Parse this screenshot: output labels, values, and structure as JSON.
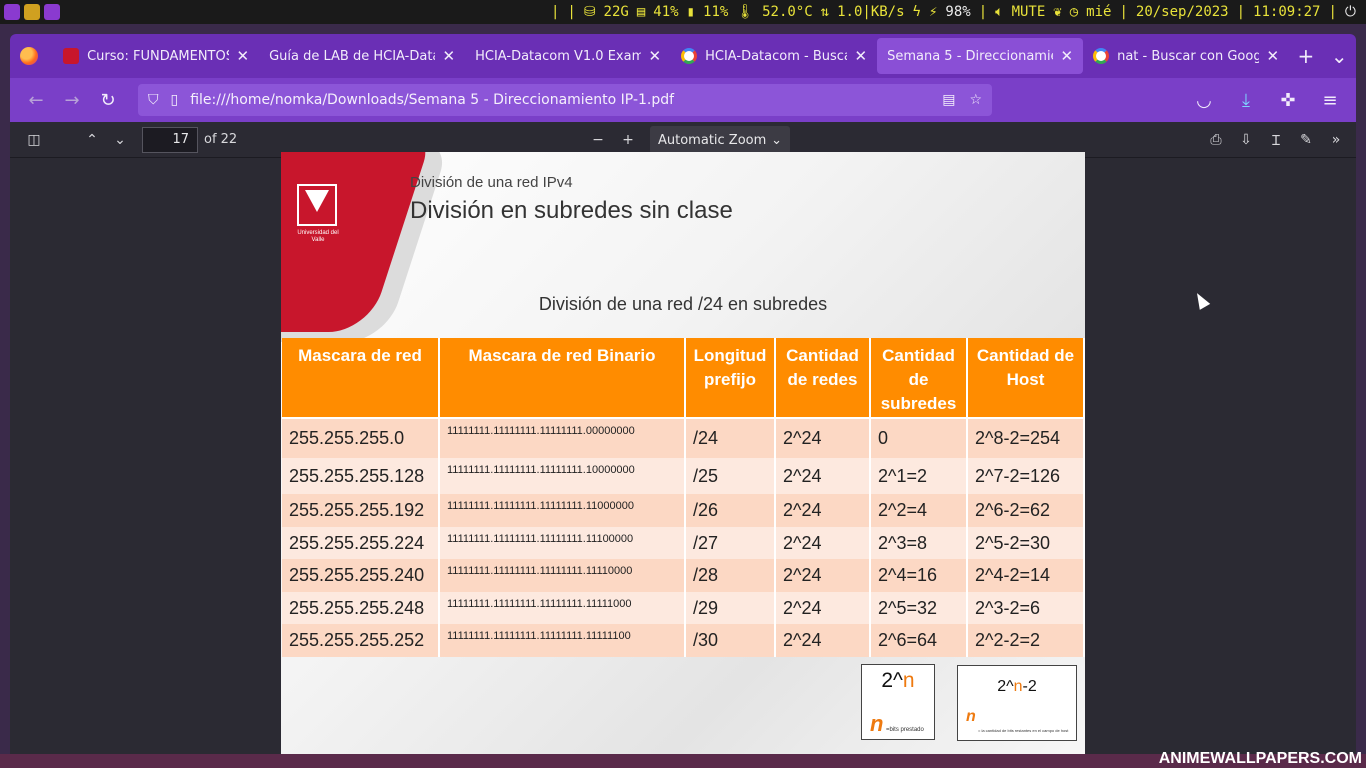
{
  "system_bar": {
    "disk": "22G",
    "memory": "41%",
    "swap": "11%",
    "temperature": "52.0°C",
    "network": "1.0|KB/s",
    "battery": "98%",
    "volume": "MUTE",
    "day": "mié",
    "date": "20/sep/2023",
    "time": "11:09:27",
    "icons": [
      "terminal-icon",
      "firefox-icon",
      "music-icon",
      "hdd-icon",
      "ram-icon",
      "swap-icon",
      "thermometer-icon",
      "network-icon",
      "bolt-icon",
      "battery-plug-icon",
      "volume-icon",
      "leaf-icon",
      "clock-icon",
      "power-icon"
    ]
  },
  "tabs": [
    {
      "title": "Curso: FUNDAMENTOS",
      "favicon": "univalle-icon",
      "active": false
    },
    {
      "title": "Guía de LAB de HCIA-Data",
      "favicon": "none",
      "active": false
    },
    {
      "title": "HCIA-Datacom V1.0 Exam",
      "favicon": "none",
      "active": false
    },
    {
      "title": "HCIA-Datacom - Buscar",
      "favicon": "google-icon",
      "active": false
    },
    {
      "title": "Semana 5 - Direccionamie",
      "favicon": "none",
      "active": true
    },
    {
      "title": "nat - Buscar con Google",
      "favicon": "google-icon",
      "active": false
    }
  ],
  "address_bar": {
    "url": "file:///home/nomka/Downloads/Semana 5 - Direccionamiento IP-1.pdf"
  },
  "pdf_toolbar": {
    "page_number": "17",
    "page_total": "of 22",
    "zoom": "Automatic Zoom"
  },
  "slide": {
    "subtitle": "División de una red IPv4",
    "title": "División en subredes sin clase",
    "logo_text": "Universidad del Valle",
    "table_caption": "División de una red /24 en subredes",
    "headers": [
      "Mascara de red",
      "Mascara de red Binario",
      "Longitud prefijo",
      "Cantidad de redes",
      "Cantidad de subredes",
      "Cantidad de Host"
    ],
    "rows": [
      [
        "255.255.255.0",
        "11111111.11111111.11111111.00000000",
        "/24",
        "2^24",
        "0",
        "2^8-2=254"
      ],
      [
        "255.255.255.128",
        "11111111.11111111.11111111.10000000",
        "/25",
        "2^24",
        "2^1=2",
        "2^7-2=126"
      ],
      [
        "255.255.255.192",
        "11111111.11111111.11111111.11000000",
        "/26",
        "2^24",
        "2^2=4",
        "2^6-2=62"
      ],
      [
        "255.255.255.224",
        "11111111.11111111.11111111.11100000",
        "/27",
        "2^24",
        "2^3=8",
        "2^5-2=30"
      ],
      [
        "255.255.255.240",
        "11111111.11111111.11111111.11110000",
        "/28",
        "2^24",
        "2^4=16",
        "2^4-2=14"
      ],
      [
        "255.255.255.248",
        "11111111.11111111.11111111.11111000",
        "/29",
        "2^24",
        "2^5=32",
        "2^3-2=6"
      ],
      [
        "255.255.255.252",
        "11111111.11111111.11111111.11111100",
        "/30",
        "2^24",
        "2^6=64",
        "2^2-2=2"
      ]
    ],
    "formula1": {
      "base": "2^",
      "exp": "n",
      "var": "n",
      "note": "=bits prestado"
    },
    "formula2": {
      "base": "2^",
      "exp": "n",
      "suffix": "-2",
      "var": "n",
      "note": "= la cantidad de bits restantes en el campo de host"
    }
  },
  "wallpaper_text": "ANIMEWALLPAPERS.COM"
}
